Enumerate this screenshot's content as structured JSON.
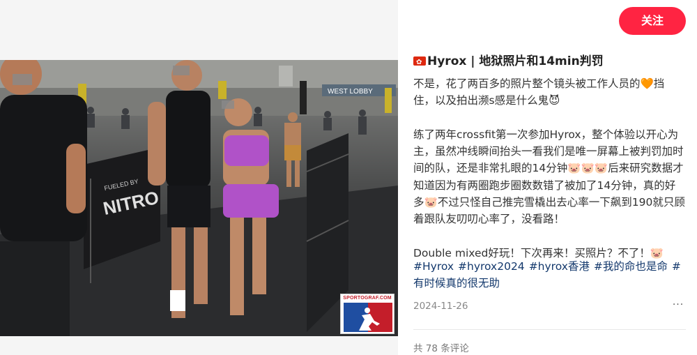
{
  "media": {
    "watermark_text": "SPORTOGRAF.COM",
    "photo_signage": {
      "lobby_sign": "WEST LOBBY",
      "barrier_text": "NITRO",
      "barrier_small_text": "FUELED BY"
    }
  },
  "header": {
    "follow_label": "关注"
  },
  "post": {
    "title": "Hyrox | 地狱照片和14min判罚",
    "paragraphs": [
      "不是，花了两百多的照片整个镜头被工作人员的🧡挡住，以及拍出濒s感是什么鬼😈",
      "练了两年crossfit第一次参加Hyrox，整个体验以开心为主，虽然冲线瞬间抬头一看我们是唯一屏幕上被判罚加时间的队，还是非常扎眼的14分钟🐷🐷🐷后来研究数据才知道因为有两圈跑步圈数数错了被加了14分钟，真的好多🐷不过只怪自己推完雪橇出去心率一下飙到190就只顾着跟队友叨叨心率了，没看路！",
      "Double mixed好玩！下次再来！买照片？不了！🐷"
    ],
    "tags": [
      "#Hyrox",
      "#hyrox2024",
      "#hyrox香港",
      "#我的命也是命",
      "#有时候真的很无助"
    ],
    "date": "2024-11-26",
    "more_label": "···",
    "comment_count": "共 78 条评论"
  },
  "colors": {
    "accent": "#ff2442",
    "tag_color": "#13386c",
    "meta_gray": "#888888"
  },
  "icons": {
    "flag": "hong-kong-flag-icon",
    "more": "more-dots-icon"
  }
}
